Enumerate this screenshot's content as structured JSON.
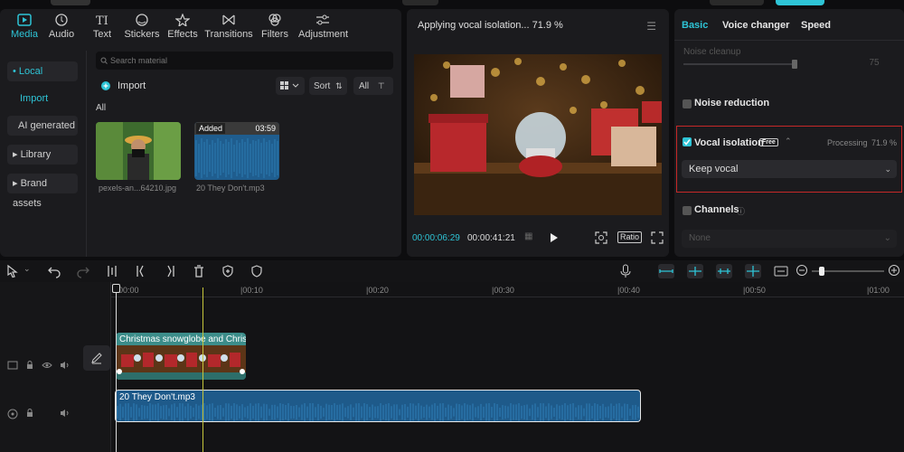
{
  "media_tabs": [
    {
      "label": "Media",
      "icon": "media-icon",
      "active": true
    },
    {
      "label": "Audio",
      "icon": "audio-icon"
    },
    {
      "label": "Text",
      "icon": "text-icon"
    },
    {
      "label": "Stickers",
      "icon": "stickers-icon"
    },
    {
      "label": "Effects",
      "icon": "effects-icon"
    },
    {
      "label": "Transitions",
      "icon": "transitions-icon"
    },
    {
      "label": "Filters",
      "icon": "filters-icon"
    },
    {
      "label": "Adjustment",
      "icon": "adjustment-icon"
    }
  ],
  "sidebar": {
    "local": "• Local",
    "import": "Import",
    "ai_generated": "AI generated",
    "library": "▸ Library",
    "brand_assets": "▸ Brand assets"
  },
  "search": {
    "placeholder": "Search material"
  },
  "toolbar_media": {
    "import": "Import",
    "sort": "Sort",
    "all": "All"
  },
  "filter_label": "All",
  "assets": [
    {
      "name": "pexels-an...64210.jpg"
    },
    {
      "name": "20 They Don't.mp3",
      "badge": "Added",
      "duration": "03:59"
    }
  ],
  "player": {
    "status": "Applying vocal isolation... 71.9 %",
    "current_time": "00:00:06:29",
    "total_time": "00:00:41:21",
    "ratio": "Ratio"
  },
  "right_panel": {
    "tabs": [
      "Basic",
      "Voice changer",
      "Speed"
    ],
    "noise_cleanup": "Noise cleanup",
    "noise_value": "75",
    "noise_reduction": "Noise reduction",
    "vocal_isolation": "Vocal isolation",
    "free_badge": "Free",
    "processing": "Processing",
    "progress": "71.9 %",
    "progress_fraction": 0.719,
    "keep_vocal": "Keep vocal",
    "channels": "Channels",
    "channels_value": "None"
  },
  "timeline": {
    "ruler": [
      "00:00",
      "|00:10",
      "|00:20",
      "|00:30",
      "|00:40",
      "|00:50",
      "|01:00"
    ],
    "video_clip": "Christmas snowglobe and Christmas",
    "audio_clip": "20 They Don't.mp3"
  },
  "colors": {
    "accent": "#2ec4d6",
    "highlight_border": "#c62828",
    "audio_clip": "#1e5a8a",
    "video_clip": "#3c8d8a"
  }
}
